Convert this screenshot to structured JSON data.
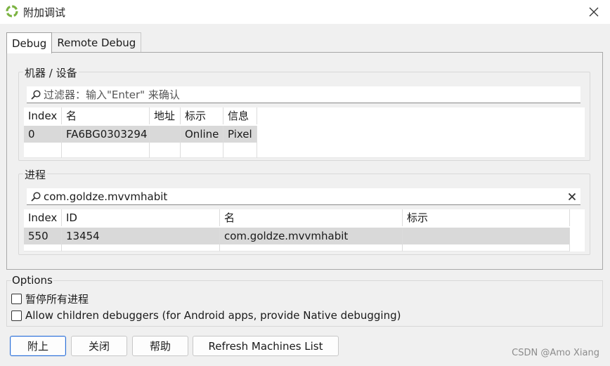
{
  "window": {
    "title": "附加调试",
    "icon": "app-logo-icon",
    "close_icon": "close-icon"
  },
  "tabs": [
    {
      "label": "Debug",
      "active": true
    },
    {
      "label": "Remote Debug",
      "active": false
    }
  ],
  "machines": {
    "group_title": "机器 / 设备",
    "filter_placeholder": "过滤器：输入\"Enter\" 来确认",
    "columns": [
      "Index",
      "名",
      "地址",
      "标示",
      "信息"
    ],
    "rows": [
      [
        "0",
        "FA6BG0303294",
        "",
        "Online",
        "Pixel"
      ]
    ]
  },
  "processes": {
    "group_title": "进程",
    "filter_value": "com.goldze.mvvmhabit",
    "clear_icon": "clear-icon",
    "columns": [
      "Index",
      "ID",
      "名",
      "标示"
    ],
    "rows": [
      [
        "550",
        "13454",
        "com.goldze.mvvmhabit",
        ""
      ]
    ]
  },
  "options": {
    "title": "Options",
    "pause_all": {
      "label": "暂停所有进程",
      "checked": false
    },
    "allow_children": {
      "label": "Allow children debuggers (for Android apps, provide Native debugging)",
      "checked": false
    }
  },
  "buttons": {
    "attach": "附上",
    "close": "关闭",
    "help": "帮助",
    "refresh": "Refresh Machines List"
  },
  "watermark": "CSDN @Amo Xiang",
  "colors": {
    "selection": "#d9d9d9",
    "primary_border": "#2b6fd6",
    "logo_green": "#7cb342"
  }
}
